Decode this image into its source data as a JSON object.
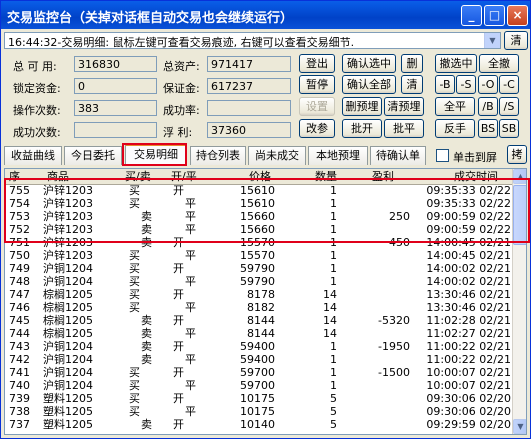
{
  "window": {
    "title": "交易监控台（关掉对话框自动交易也会继续运行）",
    "min": "_",
    "max": "□",
    "close": "×"
  },
  "log": {
    "text": "16:44:32-交易明细: 鼠标左键可查看交易痕迹, 右键可以查看交易细节.",
    "clear_label": "清",
    "arrow": "▼"
  },
  "stats": {
    "total_available_label": "总 可 用:",
    "total_available": "316830",
    "total_assets_label": "总资产:",
    "total_assets": "971417",
    "locked_funds_label": "锁定资金:",
    "locked_funds": "0",
    "margin_label": "保证金:",
    "margin": "617237",
    "operation_count_label": "操作次数:",
    "operation_count": "383",
    "success_rate_label": "成功率:",
    "success_rate": "",
    "success_count_label": "成功次数:",
    "success_count": "",
    "floating_label": "浮  利:",
    "floating": "37360"
  },
  "buttons": {
    "exit": "登出",
    "confirm_selected": "确认选中",
    "delete": "删",
    "cancel_selected": "撤选中",
    "cancel_all": "全撤",
    "pause": "暂停",
    "confirm_all": "确认全部",
    "clear": "清",
    "minus_b": "-B",
    "minus_s": "-S",
    "minus_o": "-O",
    "minus_c": "-C",
    "settings": "设置",
    "delete_preorder": "删预埋",
    "clear_preorder": "清预埋",
    "close_all": "全平",
    "b_s": "/B",
    "slash_s": "/S",
    "modify": "改参",
    "batch_open": "批开",
    "batch_close": "批平",
    "reverse": "反手",
    "bs": "BS",
    "sb": "SB"
  },
  "tabs": [
    {
      "label": "收益曲线"
    },
    {
      "label": "今日委托"
    },
    {
      "label": "交易明细"
    },
    {
      "label": "持仓列表"
    },
    {
      "label": "尚未成交"
    },
    {
      "label": "本地预埋"
    },
    {
      "label": "待确认单"
    }
  ],
  "pin_label": "单击到屏",
  "pin_checked": false,
  "extra_tab": "拷",
  "table": {
    "columns": [
      "序",
      "商品",
      "买/卖",
      "开/平",
      "价格",
      "数量",
      "盈利",
      "成交时间"
    ],
    "rows": [
      {
        "seq": "755",
        "item": "沪锌1203",
        "bs": "买",
        "oc": "开",
        "price": "15610",
        "qty": "1",
        "profit": "",
        "time": "09:35:33 02/22"
      },
      {
        "seq": "754",
        "item": "沪锌1203",
        "bs": "买",
        "oc": "平",
        "price": "15610",
        "qty": "1",
        "profit": "",
        "time": "09:35:33 02/22"
      },
      {
        "seq": "753",
        "item": "沪锌1203",
        "bs": "卖",
        "oc": "平",
        "price": "15660",
        "qty": "1",
        "profit": "250",
        "time": "09:00:59 02/22"
      },
      {
        "seq": "752",
        "item": "沪锌1203",
        "bs": "卖",
        "oc": "平",
        "price": "15660",
        "qty": "1",
        "profit": "",
        "time": "09:00:59 02/22"
      },
      {
        "seq": "751",
        "item": "沪锌1203",
        "bs": "卖",
        "oc": "开",
        "price": "15570",
        "qty": "1",
        "profit": "450",
        "time": "14:00:45 02/21"
      },
      {
        "seq": "750",
        "item": "沪锌1203",
        "bs": "买",
        "oc": "平",
        "price": "15570",
        "qty": "1",
        "profit": "",
        "time": "14:00:45 02/21"
      },
      {
        "seq": "749",
        "item": "沪铜1204",
        "bs": "买",
        "oc": "开",
        "price": "59790",
        "qty": "1",
        "profit": "",
        "time": "14:00:02 02/21"
      },
      {
        "seq": "748",
        "item": "沪铜1204",
        "bs": "买",
        "oc": "平",
        "price": "59790",
        "qty": "1",
        "profit": "",
        "time": "14:00:02 02/21"
      },
      {
        "seq": "747",
        "item": "棕榈1205",
        "bs": "买",
        "oc": "开",
        "price": "8178",
        "qty": "14",
        "profit": "",
        "time": "13:30:46 02/21"
      },
      {
        "seq": "746",
        "item": "棕榈1205",
        "bs": "买",
        "oc": "平",
        "price": "8182",
        "qty": "14",
        "profit": "",
        "time": "13:30:46 02/21"
      },
      {
        "seq": "745",
        "item": "棕榈1205",
        "bs": "卖",
        "oc": "开",
        "price": "8144",
        "qty": "14",
        "profit": "-5320",
        "time": "11:02:28 02/21"
      },
      {
        "seq": "744",
        "item": "棕榈1205",
        "bs": "卖",
        "oc": "平",
        "price": "8144",
        "qty": "14",
        "profit": "",
        "time": "11:02:27 02/21"
      },
      {
        "seq": "743",
        "item": "沪铜1204",
        "bs": "卖",
        "oc": "开",
        "price": "59400",
        "qty": "1",
        "profit": "-1950",
        "time": "11:00:22 02/21"
      },
      {
        "seq": "742",
        "item": "沪铜1204",
        "bs": "卖",
        "oc": "平",
        "price": "59400",
        "qty": "1",
        "profit": "",
        "time": "11:00:22 02/21"
      },
      {
        "seq": "741",
        "item": "沪铜1204",
        "bs": "买",
        "oc": "开",
        "price": "59700",
        "qty": "1",
        "profit": "-1500",
        "time": "10:00:07 02/21"
      },
      {
        "seq": "740",
        "item": "沪铜1204",
        "bs": "买",
        "oc": "平",
        "price": "59700",
        "qty": "1",
        "profit": "",
        "time": "10:00:07 02/21"
      },
      {
        "seq": "739",
        "item": "塑料1205",
        "bs": "买",
        "oc": "开",
        "price": "10175",
        "qty": "5",
        "profit": "",
        "time": "09:30:06 02/20"
      },
      {
        "seq": "738",
        "item": "塑料1205",
        "bs": "买",
        "oc": "平",
        "price": "10175",
        "qty": "5",
        "profit": "",
        "time": "09:30:06 02/20"
      },
      {
        "seq": "737",
        "item": "塑料1205",
        "bs": "卖",
        "oc": "开",
        "price": "10140",
        "qty": "5",
        "profit": "",
        "time": "09:29:59 02/20"
      }
    ]
  },
  "scrollbar": {
    "up": "▲",
    "down": "▼"
  }
}
